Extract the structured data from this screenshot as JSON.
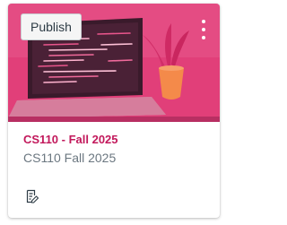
{
  "card": {
    "publish_label": "Publish",
    "course_code": "CS110 - Fall 2025",
    "course_term": "CS110 Fall 2025",
    "accent_color": "#c2185b",
    "hero_overlay_color": "#e0306f",
    "menu_icon": "kebab-menu-icon",
    "footer_icon": "assignments-icon"
  }
}
